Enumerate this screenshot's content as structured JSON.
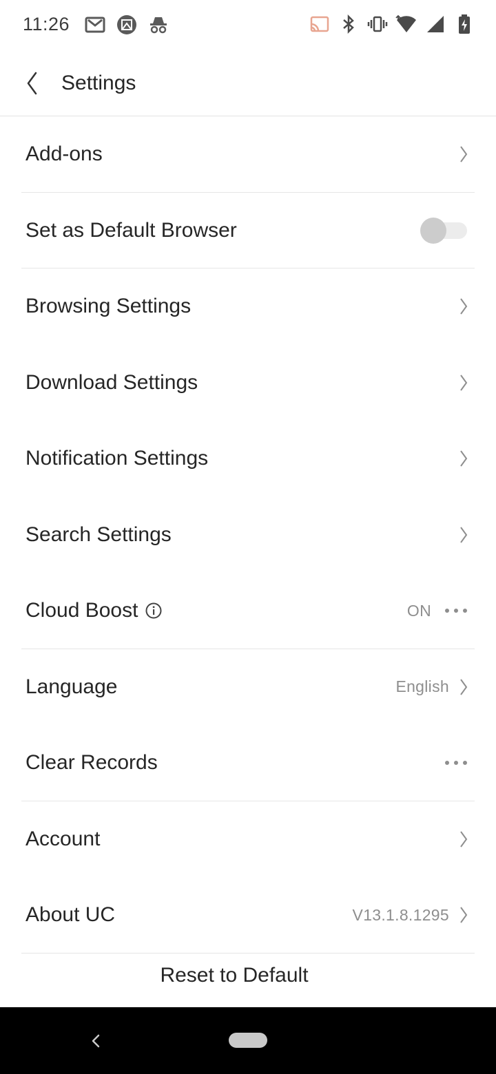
{
  "status_bar": {
    "time": "11:26",
    "left_icons": [
      "gmail-icon",
      "photo-icon",
      "incognito-icon"
    ],
    "right_icons": [
      "cast-icon",
      "bluetooth-icon",
      "vibrate-icon",
      "wifi-icon",
      "signal-icon",
      "battery-icon"
    ]
  },
  "header": {
    "back_icon": "back-chevron-icon",
    "title": "Settings"
  },
  "settings": {
    "addons": {
      "label": "Add-ons"
    },
    "default_browser": {
      "label": "Set as Default Browser",
      "toggle_on": false
    },
    "browsing": {
      "label": "Browsing Settings"
    },
    "download": {
      "label": "Download Settings"
    },
    "notification": {
      "label": "Notification Settings"
    },
    "search": {
      "label": "Search Settings"
    },
    "cloud_boost": {
      "label": "Cloud Boost",
      "value": "ON"
    },
    "language": {
      "label": "Language",
      "value": "English"
    },
    "clear_records": {
      "label": "Clear Records"
    },
    "account": {
      "label": "Account"
    },
    "about": {
      "label": "About UC",
      "value": "V13.1.8.1295"
    }
  },
  "reset_label": "Reset to Default",
  "colors": {
    "text_primary": "#262626",
    "text_secondary": "#8e8e8e",
    "divider": "#e6e6e6",
    "nav_bar": "#000000"
  }
}
